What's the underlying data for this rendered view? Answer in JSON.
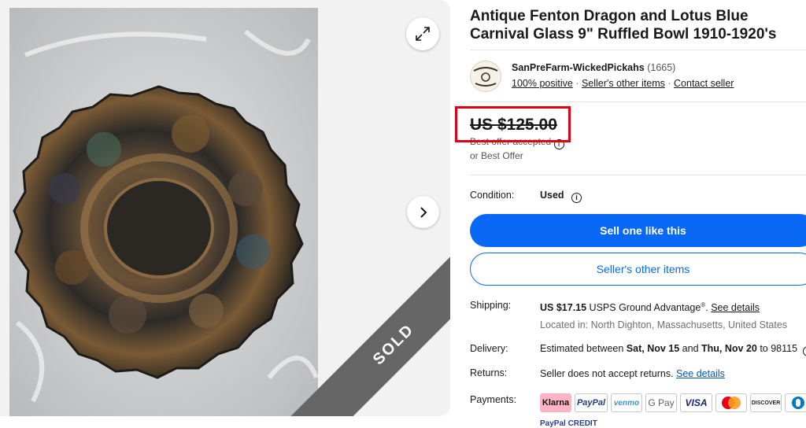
{
  "gallery": {
    "expand_icon": "expand-arrows-icon",
    "next_icon": "chevron-right-icon",
    "sold_label": "SOLD"
  },
  "listing": {
    "title": "Antique Fenton Dragon and Lotus Blue Carnival Glass 9\" Ruffled Bowl 1910-1920's"
  },
  "seller": {
    "name": "SanPreFarm-WickedPickahs",
    "feedback_count": "(1665)",
    "positive": "100% positive",
    "sep1": "·",
    "other_items": "Seller's other items",
    "sep2": "·",
    "contact": "Contact seller"
  },
  "price": {
    "amount": "US $125.00",
    "best_offer_accepted": "Best offer accepted",
    "or_best_offer": "or Best Offer"
  },
  "condition": {
    "label": "Condition:",
    "value": "Used"
  },
  "buttons": {
    "sell_one": "Sell one like this",
    "other_items": "Seller's other items"
  },
  "shipping": {
    "label": "Shipping:",
    "price": "US $17.15",
    "service": " USPS Ground Advantage",
    "reg": "®",
    "dot": ".",
    "details": "See details",
    "located": "Located in: North Dighton, Massachusetts, United States"
  },
  "delivery": {
    "label": "Delivery:",
    "prefix": "Estimated between ",
    "start": "Sat, Nov 15",
    "and": " and ",
    "end": "Thu, Nov 20",
    "to": " to 98115"
  },
  "returns": {
    "label": "Returns:",
    "text": "Seller does not accept returns. ",
    "details": "See details"
  },
  "payments": {
    "label": "Payments:",
    "methods": [
      "Klarna",
      "PayPal",
      "venmo",
      "G Pay",
      "VISA",
      "Mastercard",
      "DISCOVER",
      "Diners"
    ],
    "partial_text": "PayPal CREDIT"
  },
  "colors": {
    "accent_blue": "#0968f6",
    "highlight_red": "#e0000f",
    "klarna_pink": "#ffb3c7"
  }
}
